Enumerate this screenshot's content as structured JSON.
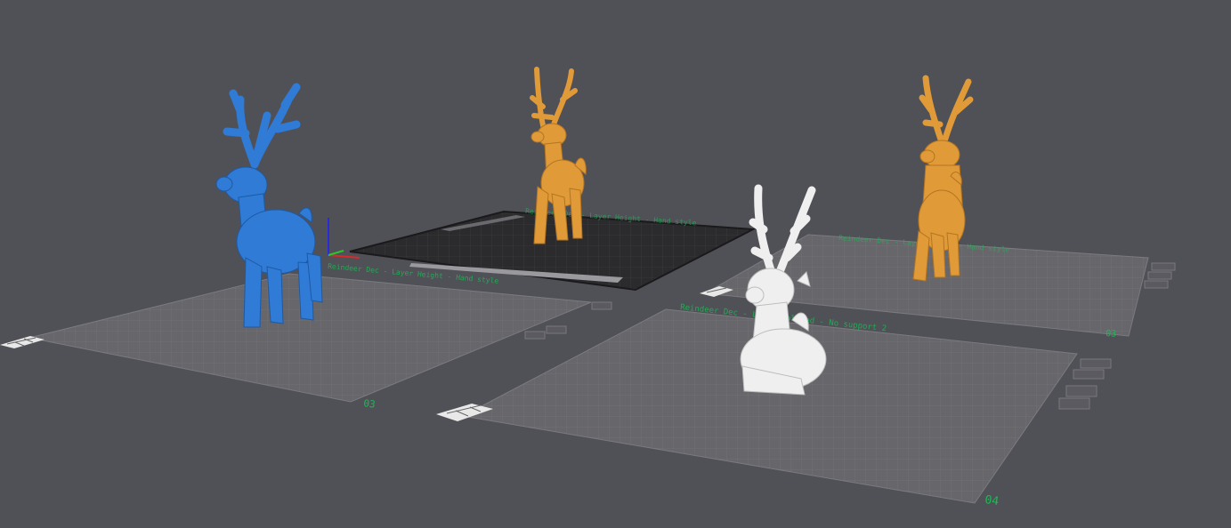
{
  "scene": {
    "background": "#505057",
    "plate_color": "#67676d",
    "plate_grid_color": "#76767c",
    "active_plate_color": "#2b2b2e",
    "label_color": "#1db954"
  },
  "plates": [
    {
      "number": "03",
      "header": "Reindeer Dec - Layer Height - Hand style",
      "model_color": "#2f7bd6"
    },
    {
      "number": "",
      "header": "Reindeer Dec - Layer Height - Hand style",
      "model_color": "#e09a37"
    },
    {
      "number": "03",
      "header": "Reindeer Dec - Layer Height - Hand style",
      "model_color": "#e09a37"
    },
    {
      "number": "04",
      "header": "Reindeer Dec - Layer Colored - No support 2",
      "model_color": "#efefef"
    }
  ],
  "icons": [
    "plate-arrange-icon",
    "plate-lock-icon",
    "plate-settings-icon",
    "plate-slice-icon",
    "plate-orient-icon"
  ]
}
